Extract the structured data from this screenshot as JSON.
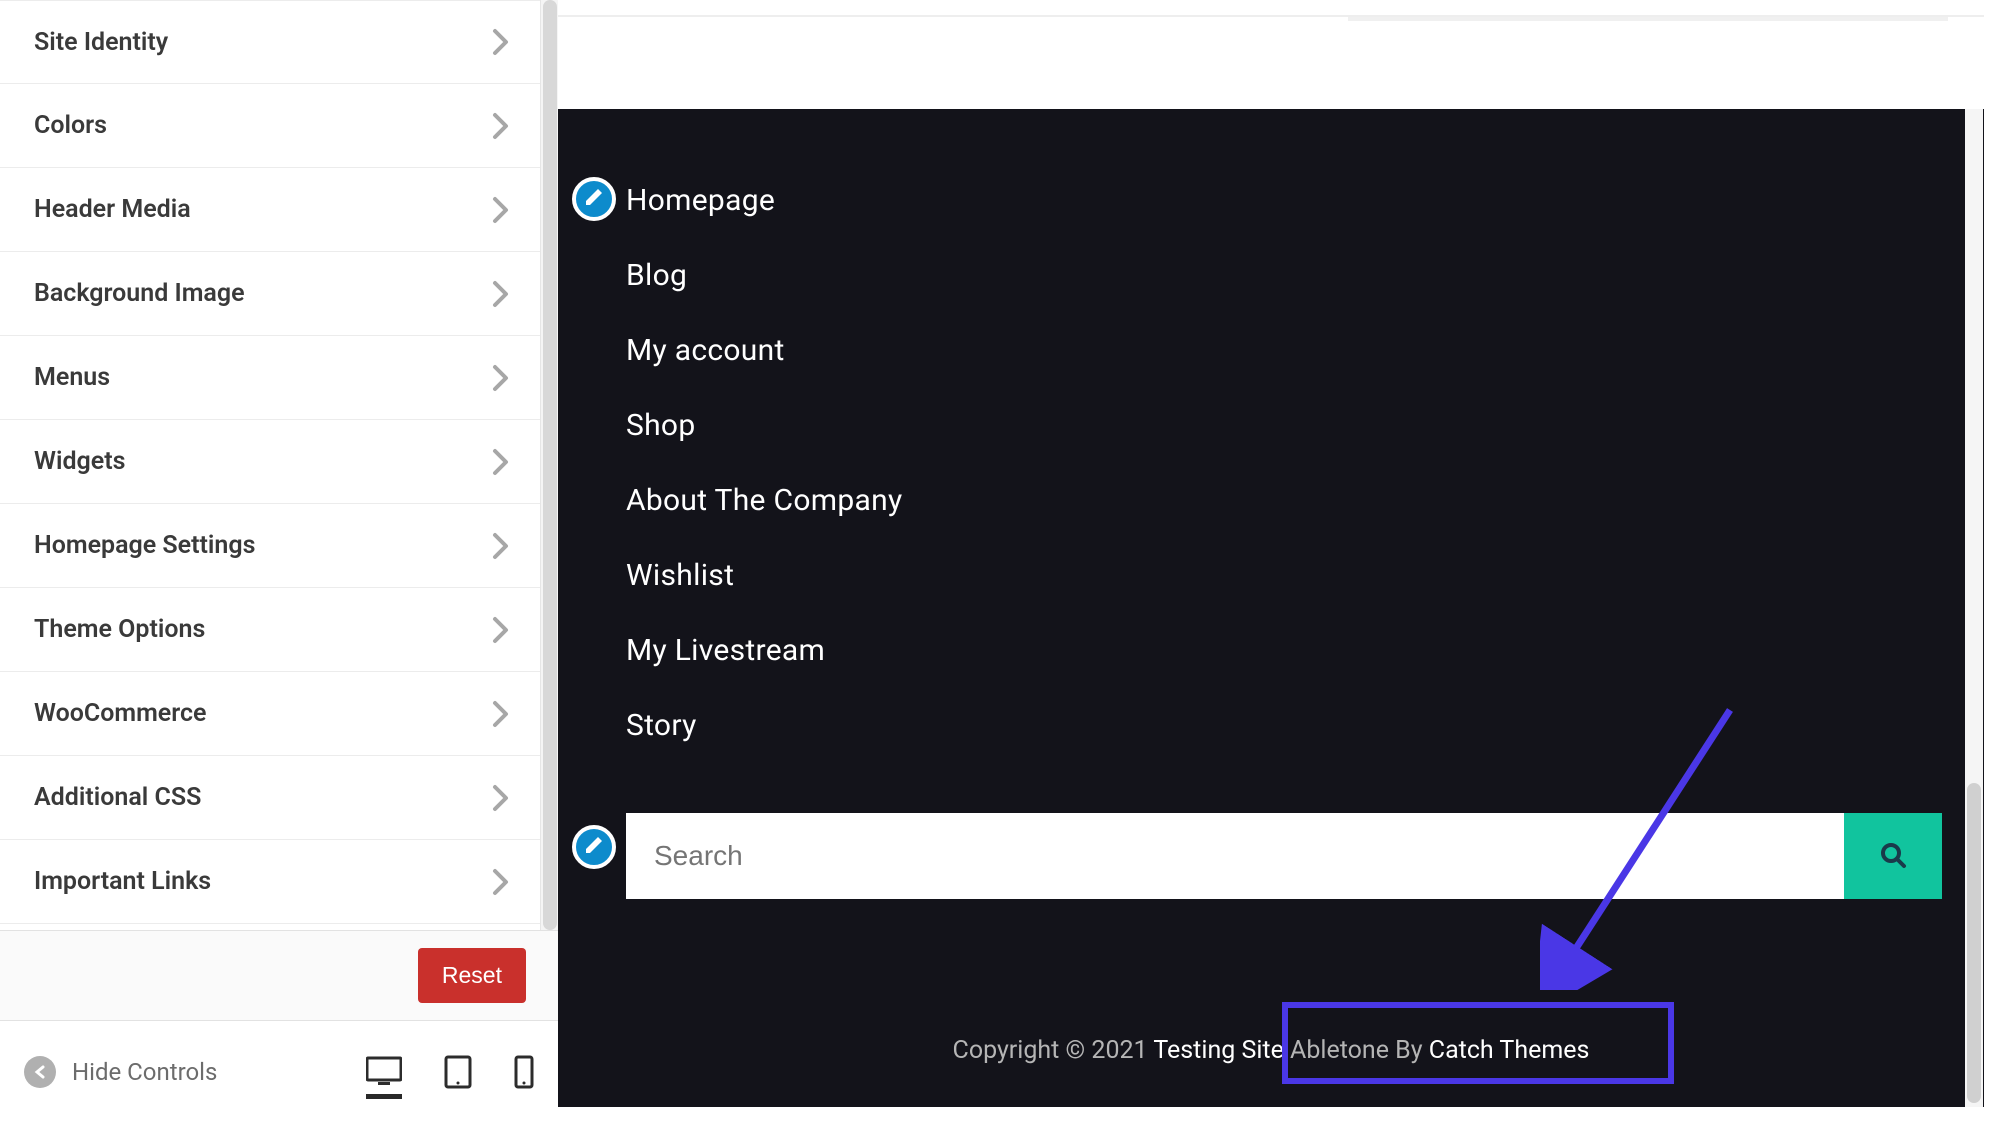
{
  "sidebar": {
    "items": [
      {
        "label": "Site Identity"
      },
      {
        "label": "Colors"
      },
      {
        "label": "Header Media"
      },
      {
        "label": "Background Image"
      },
      {
        "label": "Menus"
      },
      {
        "label": "Widgets"
      },
      {
        "label": "Homepage Settings"
      },
      {
        "label": "Theme Options"
      },
      {
        "label": "WooCommerce"
      },
      {
        "label": "Additional CSS"
      },
      {
        "label": "Important Links"
      }
    ],
    "reset_label": "Reset",
    "hide_controls_label": "Hide Controls"
  },
  "preview": {
    "menu_widget": {
      "items": [
        "Homepage",
        "Blog",
        "My account",
        "Shop",
        "About The Company",
        "Wishlist",
        "My Livestream",
        "Story"
      ]
    },
    "search_widget": {
      "placeholder": "Search"
    },
    "copyright": {
      "prefix": "Copyright © 2021 ",
      "site": "Testing Site",
      "sep": "  ",
      "theme_by": "Abletone By ",
      "author": "Catch Themes"
    }
  },
  "colors": {
    "accent_turquoise": "#11c49e",
    "edit_badge_blue": "#0d8bcc",
    "reset_red": "#c9302c",
    "preview_dark_bg": "#13131a",
    "annotation_purple": "#4a37e6"
  }
}
